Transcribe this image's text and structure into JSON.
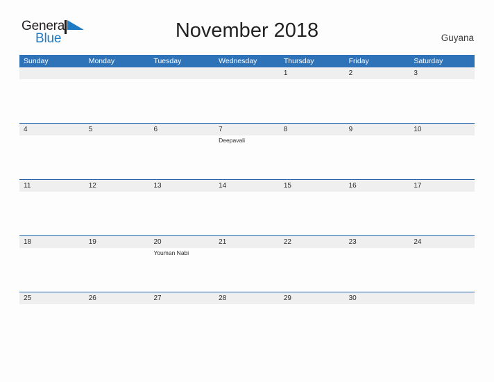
{
  "brand": {
    "name_part1": "General",
    "name_part2": "Blue",
    "flag_icon": "blue-flag-triangle-icon",
    "color_dark": "#231f20",
    "color_blue": "#1f7ac4"
  },
  "header": {
    "title": "November 2018",
    "region": "Guyana"
  },
  "calendar": {
    "accent_color": "#2e72b8",
    "row_border_color": "#2166a8",
    "date_band_color": "#efefef",
    "weekdays": [
      "Sunday",
      "Monday",
      "Tuesday",
      "Wednesday",
      "Thursday",
      "Friday",
      "Saturday"
    ],
    "weeks": [
      [
        {
          "date": "",
          "events": []
        },
        {
          "date": "",
          "events": []
        },
        {
          "date": "",
          "events": []
        },
        {
          "date": "",
          "events": []
        },
        {
          "date": "1",
          "events": []
        },
        {
          "date": "2",
          "events": []
        },
        {
          "date": "3",
          "events": []
        }
      ],
      [
        {
          "date": "4",
          "events": []
        },
        {
          "date": "5",
          "events": []
        },
        {
          "date": "6",
          "events": []
        },
        {
          "date": "7",
          "events": [
            "Deepavali"
          ]
        },
        {
          "date": "8",
          "events": []
        },
        {
          "date": "9",
          "events": []
        },
        {
          "date": "10",
          "events": []
        }
      ],
      [
        {
          "date": "11",
          "events": []
        },
        {
          "date": "12",
          "events": []
        },
        {
          "date": "13",
          "events": []
        },
        {
          "date": "14",
          "events": []
        },
        {
          "date": "15",
          "events": []
        },
        {
          "date": "16",
          "events": []
        },
        {
          "date": "17",
          "events": []
        }
      ],
      [
        {
          "date": "18",
          "events": []
        },
        {
          "date": "19",
          "events": []
        },
        {
          "date": "20",
          "events": [
            "Youman Nabi"
          ]
        },
        {
          "date": "21",
          "events": []
        },
        {
          "date": "22",
          "events": []
        },
        {
          "date": "23",
          "events": []
        },
        {
          "date": "24",
          "events": []
        }
      ],
      [
        {
          "date": "25",
          "events": []
        },
        {
          "date": "26",
          "events": []
        },
        {
          "date": "27",
          "events": []
        },
        {
          "date": "28",
          "events": []
        },
        {
          "date": "29",
          "events": []
        },
        {
          "date": "30",
          "events": []
        },
        {
          "date": "",
          "events": []
        }
      ]
    ]
  }
}
